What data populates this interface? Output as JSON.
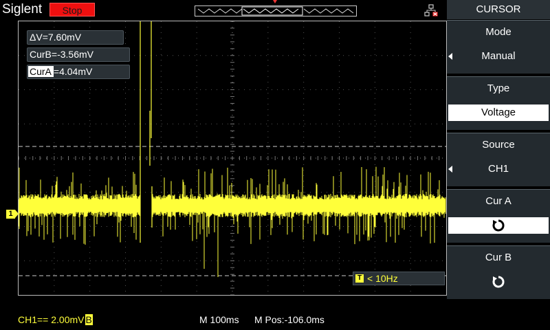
{
  "header": {
    "brand": "Siglent",
    "run_state": "Stop"
  },
  "readouts": {
    "delta_v": "ΔV=7.60mV",
    "cur_b": "CurB=-3.56mV",
    "cur_a_name": "CurA",
    "cur_a_value": "=4.04mV"
  },
  "trigger": {
    "freq": "< 10Hz",
    "icon_letter": "T"
  },
  "channel_marker": "1",
  "footer": {
    "ch1_scale": "CH1== 2.00mV",
    "bw_badge": "B",
    "timebase": "M 100ms",
    "mpos": "M Pos:-106.0ms"
  },
  "menu": {
    "title": "CURSOR",
    "items": [
      {
        "label": "Mode",
        "value": "Manual"
      },
      {
        "label": "Type",
        "value": "Voltage"
      },
      {
        "label": "Source",
        "value": "CH1"
      },
      {
        "label": "Cur A"
      },
      {
        "label": "Cur B"
      }
    ]
  },
  "colors": {
    "ch1": "#ffff3a",
    "stop": "#ee0f0f",
    "panel": "#232a2f"
  },
  "icons": [
    "network-icon",
    "rotate-knob-icon"
  ]
}
